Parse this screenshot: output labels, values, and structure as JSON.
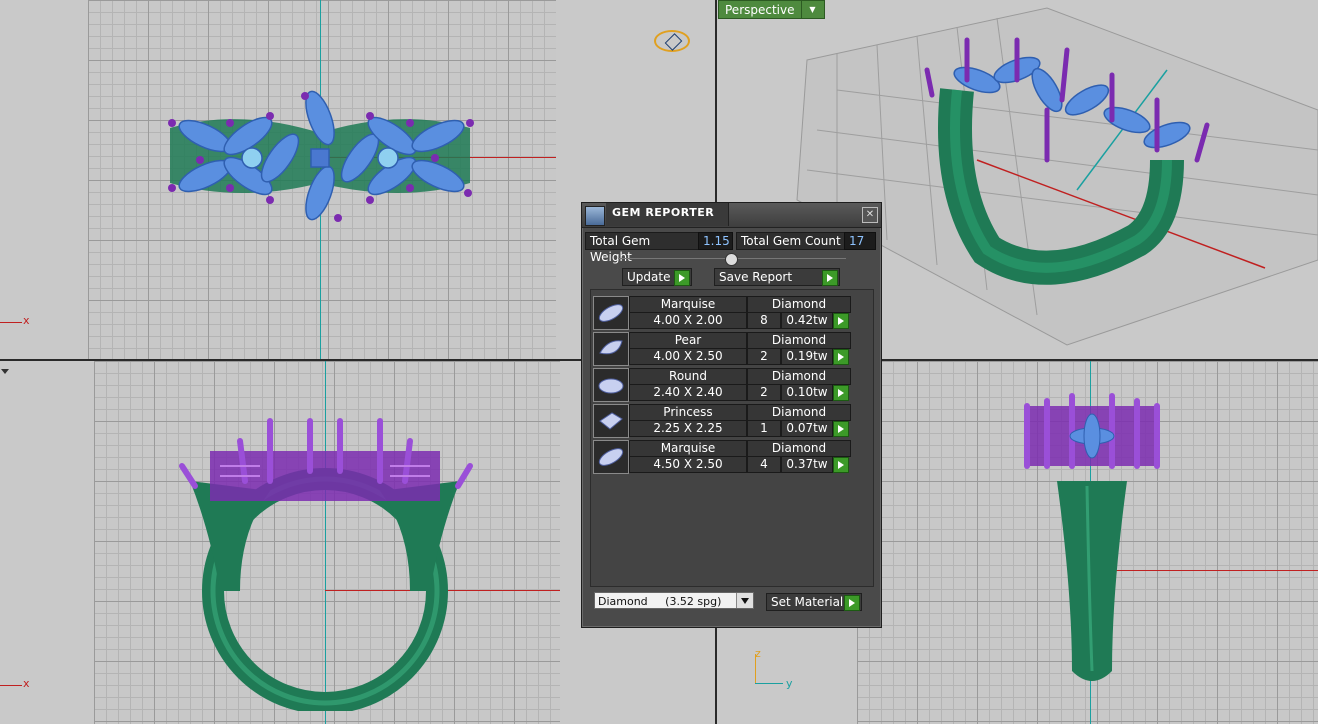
{
  "viewports": {
    "perspective_label": "Perspective",
    "axis_x": "x",
    "axis_y": "y",
    "axis_z": "z"
  },
  "gem_reporter": {
    "title": "GEM REPORTER",
    "total_gem_weight_label": "Total Gem Weight",
    "total_gem_weight_value": "1.15",
    "total_gem_count_label": "Total Gem Count",
    "total_gem_count_value": "17",
    "update_label": "Update",
    "save_report_label": "Save Report",
    "gems": [
      {
        "shape": "Marquise",
        "size": "4.00 X 2.00",
        "material": "Diamond",
        "count": "8",
        "weight": "0.42tw"
      },
      {
        "shape": "Pear",
        "size": "4.00 X 2.50",
        "material": "Diamond",
        "count": "2",
        "weight": "0.19tw"
      },
      {
        "shape": "Round",
        "size": "2.40 X 2.40",
        "material": "Diamond",
        "count": "2",
        "weight": "0.10tw"
      },
      {
        "shape": "Princess",
        "size": "2.25 X 2.25",
        "material": "Diamond",
        "count": "1",
        "weight": "0.07tw"
      },
      {
        "shape": "Marquise",
        "size": "4.50 X 2.50",
        "material": "Diamond",
        "count": "4",
        "weight": "0.37tw"
      }
    ],
    "material_select": "Diamond     (3.52 spg)",
    "set_material_label": "Set Material"
  },
  "colors": {
    "metal_green": "#1f7a55",
    "prong_purple": "#7b2bb0",
    "gem_blue": "#5a8fe0",
    "axis_red": "#c02020",
    "axis_teal": "#1aa0a0",
    "go_green": "#3c9a28"
  }
}
